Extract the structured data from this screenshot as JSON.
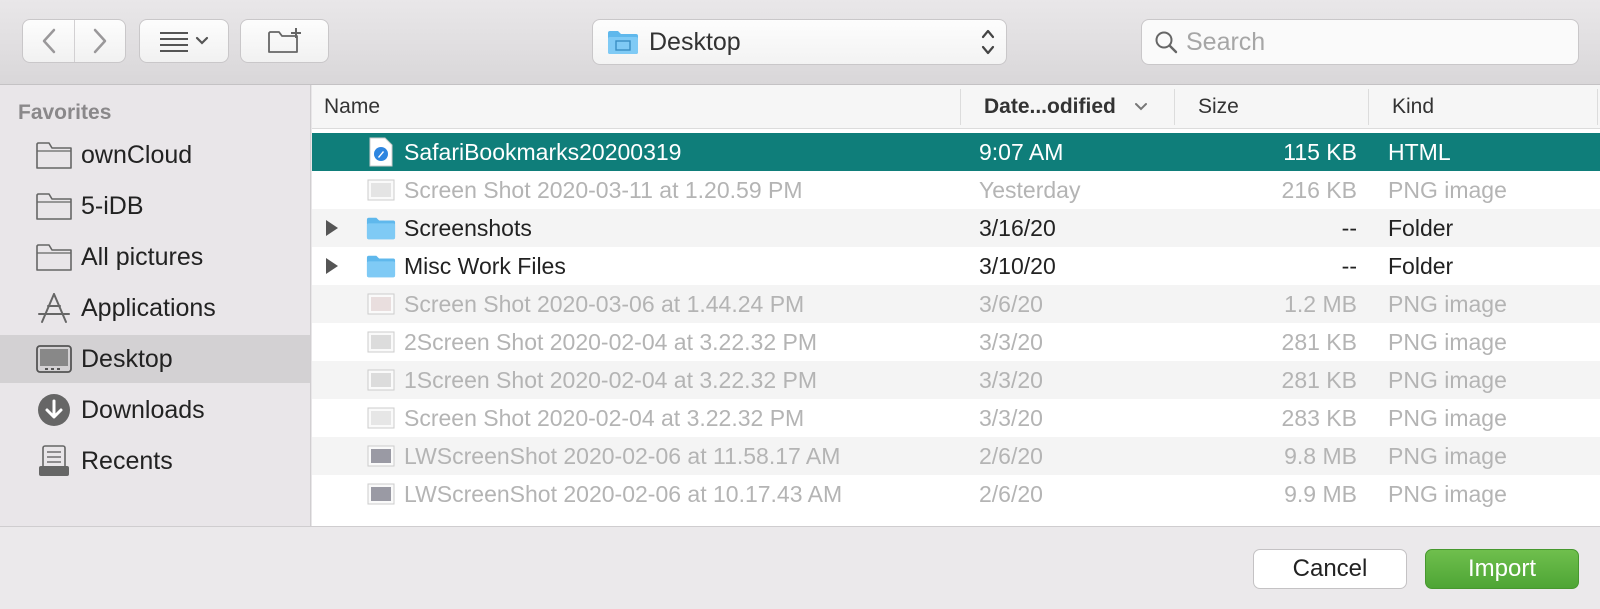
{
  "toolbar": {
    "path_label": "Desktop",
    "search_placeholder": "Search"
  },
  "sidebar": {
    "heading": "Favorites",
    "items": [
      {
        "label": "ownCloud",
        "icon": "folder-icon"
      },
      {
        "label": "5-iDB",
        "icon": "folder-icon"
      },
      {
        "label": "All pictures",
        "icon": "folder-icon"
      },
      {
        "label": "Applications",
        "icon": "applications-icon"
      },
      {
        "label": "Desktop",
        "icon": "desktop-icon",
        "selected": true
      },
      {
        "label": "Downloads",
        "icon": "downloads-icon"
      },
      {
        "label": "Recents",
        "icon": "recents-icon"
      }
    ]
  },
  "columns": {
    "name": "Name",
    "date": "Date...odified",
    "size": "Size",
    "kind": "Kind"
  },
  "files": [
    {
      "name": "SafariBookmarks20200319",
      "date": "9:07 AM",
      "size": "115 KB",
      "kind": "HTML",
      "icon": "html-file-icon",
      "selected": true
    },
    {
      "name": "Screen Shot 2020-03-11 at 1.20.59 PM",
      "date": "Yesterday",
      "size": "216 KB",
      "kind": "PNG image",
      "icon": "png-file-icon",
      "disabled": true
    },
    {
      "name": "Screenshots",
      "date": "3/16/20",
      "size": "--",
      "kind": "Folder",
      "icon": "folder-icon",
      "folder": true
    },
    {
      "name": "Misc Work Files",
      "date": "3/10/20",
      "size": "--",
      "kind": "Folder",
      "icon": "folder-icon",
      "folder": true
    },
    {
      "name": "Screen Shot 2020-03-06 at 1.44.24 PM",
      "date": "3/6/20",
      "size": "1.2 MB",
      "kind": "PNG image",
      "icon": "png-file-icon",
      "disabled": true
    },
    {
      "name": "2Screen Shot 2020-02-04 at 3.22.32 PM",
      "date": "3/3/20",
      "size": "281 KB",
      "kind": "PNG image",
      "icon": "png-file-icon",
      "disabled": true
    },
    {
      "name": "1Screen Shot 2020-02-04 at 3.22.32 PM",
      "date": "3/3/20",
      "size": "281 KB",
      "kind": "PNG image",
      "icon": "png-file-icon",
      "disabled": true
    },
    {
      "name": "Screen Shot 2020-02-04 at 3.22.32 PM",
      "date": "3/3/20",
      "size": "283 KB",
      "kind": "PNG image",
      "icon": "png-file-icon",
      "disabled": true
    },
    {
      "name": "LWScreenShot 2020-02-06 at 11.58.17 AM",
      "date": "2/6/20",
      "size": "9.8 MB",
      "kind": "PNG image",
      "icon": "png-file-icon",
      "disabled": true
    },
    {
      "name": "LWScreenShot 2020-02-06 at 10.17.43 AM",
      "date": "2/6/20",
      "size": "9.9 MB",
      "kind": "PNG image",
      "icon": "png-file-icon",
      "disabled": true
    }
  ],
  "footer": {
    "cancel_label": "Cancel",
    "import_label": "Import"
  },
  "colors": {
    "selection": "#0f7e7a",
    "import_button": "#4ea535",
    "folder_blue": "#6cc4f5"
  }
}
